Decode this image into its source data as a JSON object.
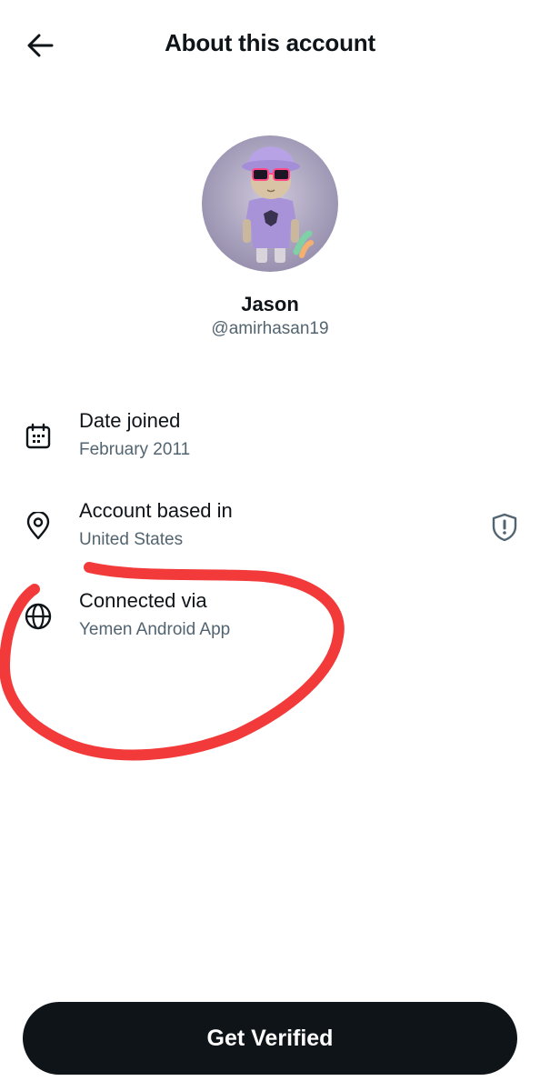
{
  "header": {
    "title": "About this account",
    "back_icon": "arrow-left-icon"
  },
  "profile": {
    "display_name": "Jason",
    "handle": "@amirhasan19"
  },
  "info": [
    {
      "icon": "calendar-icon",
      "label": "Date joined",
      "value": "February 2011"
    },
    {
      "icon": "location-pin-icon",
      "label": "Account based in",
      "value": "United States",
      "badge_icon": "shield-alert-icon"
    },
    {
      "icon": "globe-icon",
      "label": "Connected via",
      "value": "Yemen Android App"
    }
  ],
  "annotation": {
    "color": "#f23a3a"
  },
  "cta": {
    "label": "Get Verified"
  },
  "colors": {
    "text_primary": "#0f1419",
    "text_secondary": "#536471",
    "button_bg": "#0f1419"
  }
}
